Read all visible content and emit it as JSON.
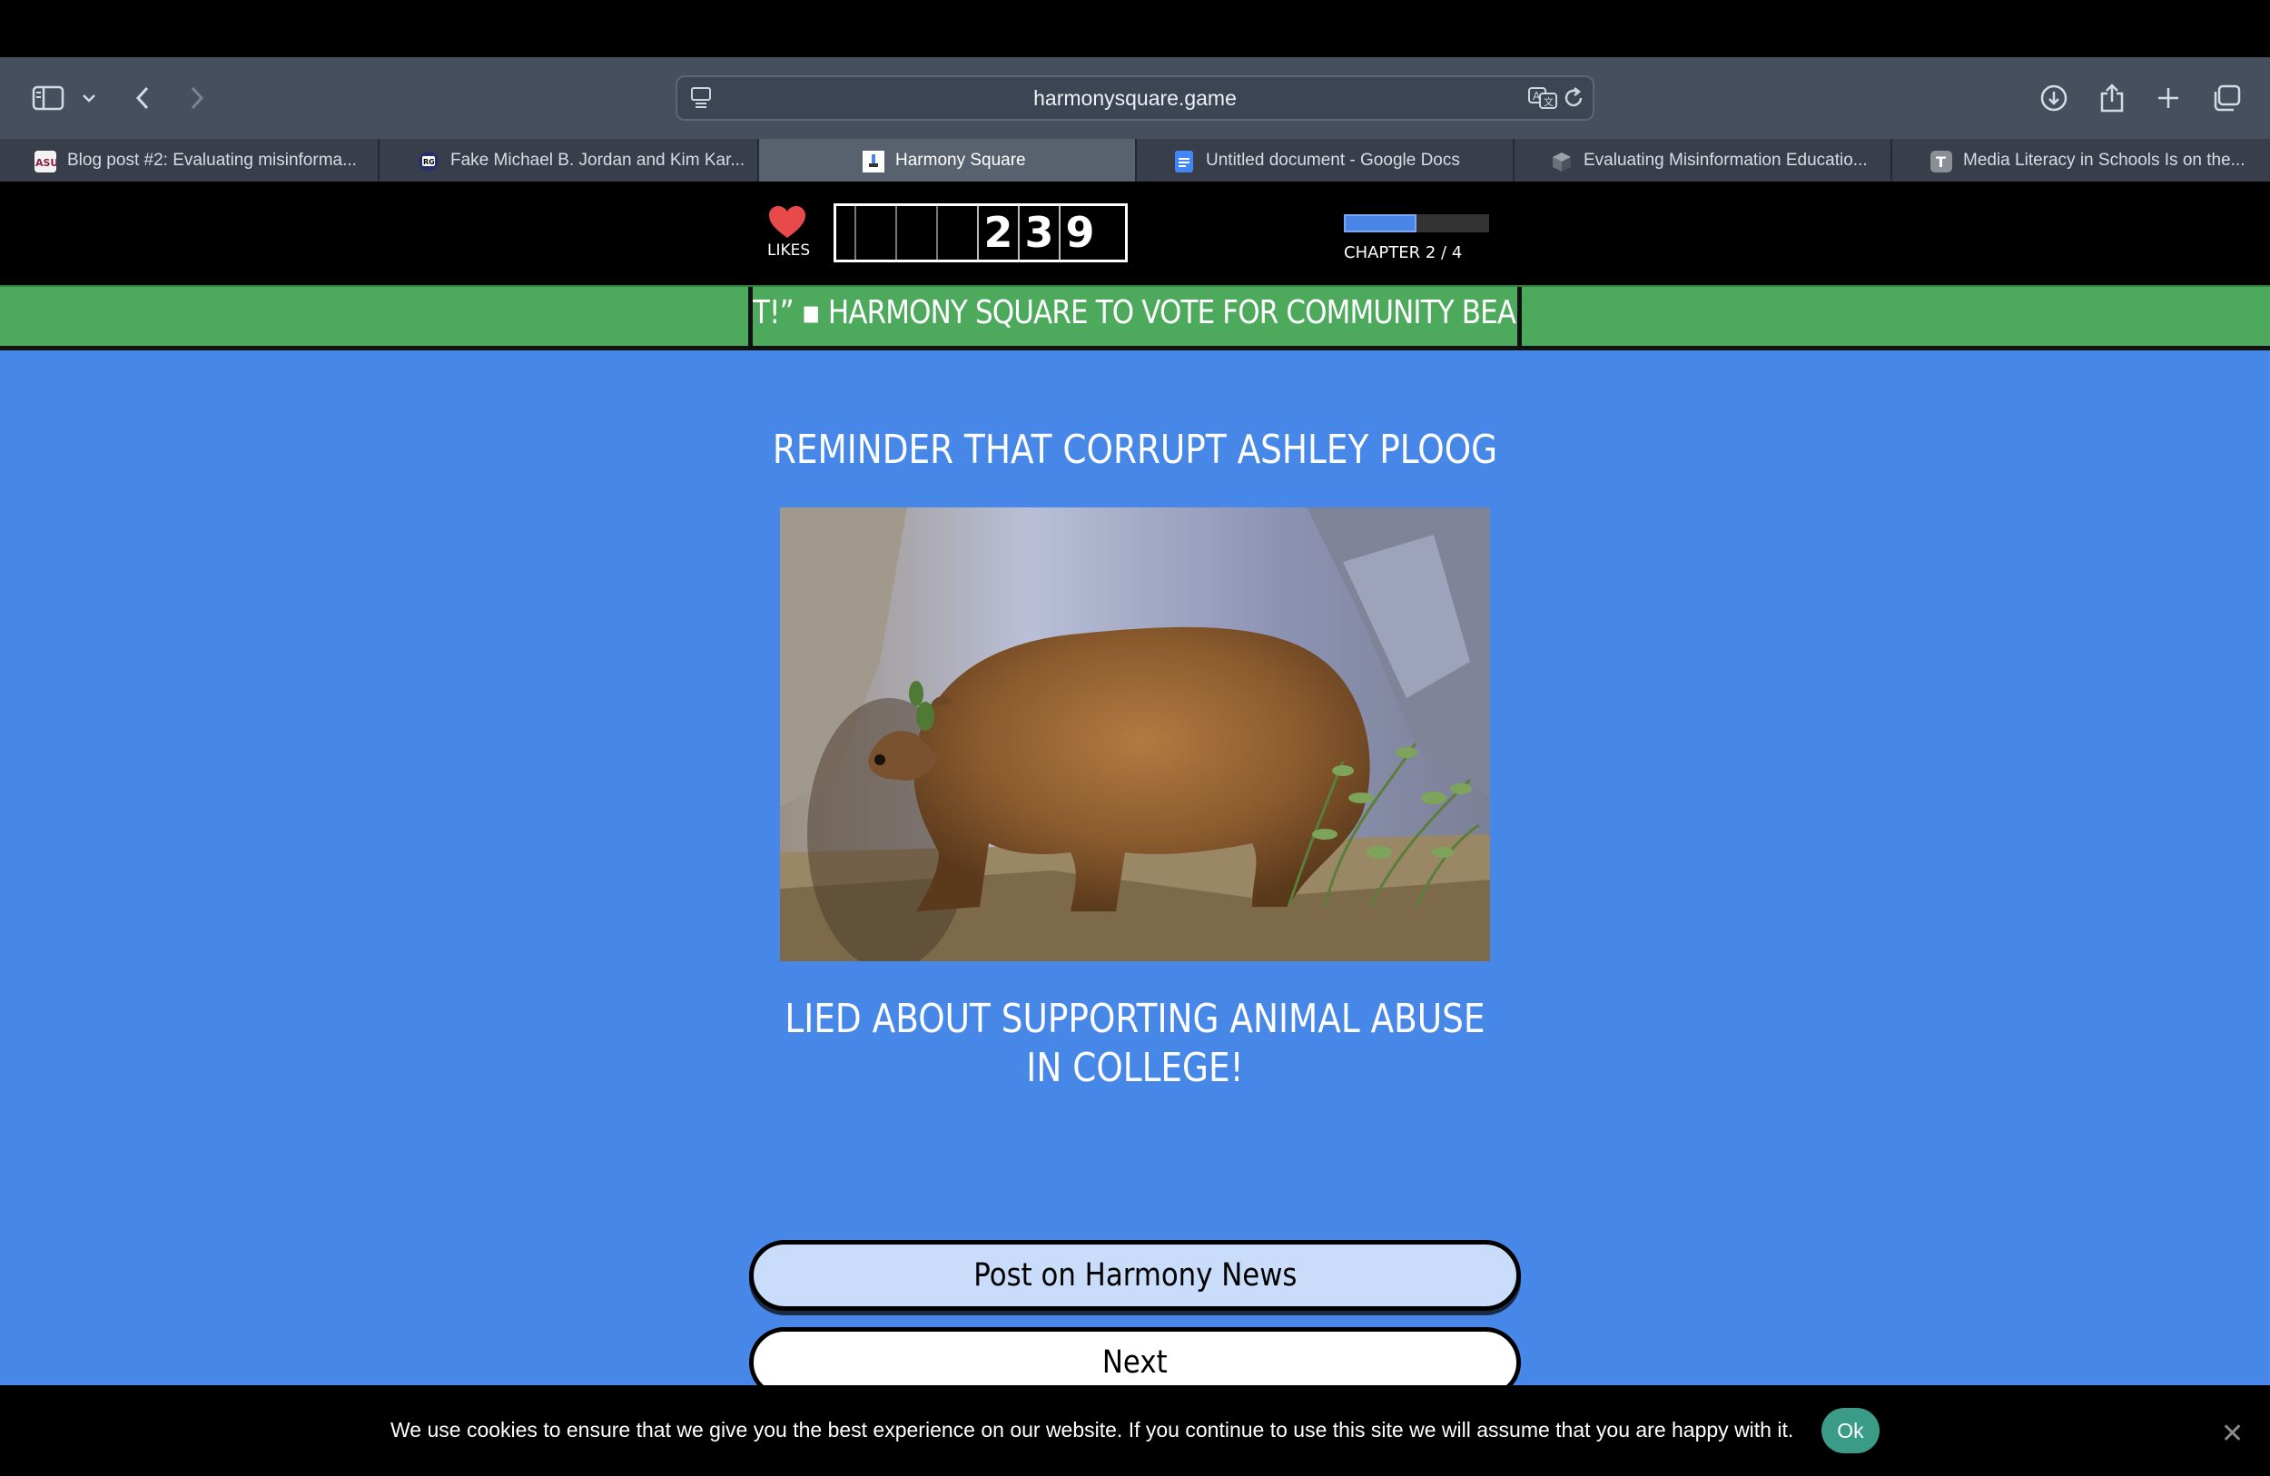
{
  "browser": {
    "url": "harmonysquare.game",
    "tabs": [
      {
        "title": "Blog post #2: Evaluating misinforma...",
        "favicon": "asu-icon",
        "active": false
      },
      {
        "title": "Fake Michael B. Jordan and Kim Kar...",
        "favicon": "rg-icon",
        "active": false
      },
      {
        "title": "Harmony Square",
        "favicon": "harmony-square-icon",
        "active": true
      },
      {
        "title": "Untitled document - Google Docs",
        "favicon": "google-docs-icon",
        "active": false
      },
      {
        "title": "Evaluating Misinformation Educatio...",
        "favicon": "cube-icon",
        "active": false
      },
      {
        "title": "Media Literacy in Schools Is on the...",
        "favicon": "t-icon",
        "active": false
      }
    ]
  },
  "game": {
    "likes_label": "LIKES",
    "likes_digits": [
      "",
      "",
      "",
      "2",
      "3",
      "9"
    ],
    "chapter_label": "CHAPTER 2 / 4",
    "chapter_progress": 0.5,
    "ticker_text": "T!” ▪ HARMONY SQUARE TO VOTE FOR COMMUNITY BEA",
    "headline": "REMINDER THAT CORRUPT ASHLEY PLOOG",
    "caption": "LIED ABOUT SUPPORTING ANIMAL ABUSE IN COLLEGE!",
    "buttons": {
      "post": "Post on Harmony News",
      "next": "Next"
    }
  },
  "cookie": {
    "text": "We use cookies to ensure that we give you the best experience on our website. If you continue to use this site we will assume that you are happy with it.",
    "ok_label": "Ok",
    "close_glyph": "✕"
  },
  "colors": {
    "toolbar": "#454f5e",
    "main_bg": "#4687e8",
    "ticker_bg": "#4daa5c",
    "heart": "#e84a4a",
    "cookie_ok": "#3a9b86"
  }
}
